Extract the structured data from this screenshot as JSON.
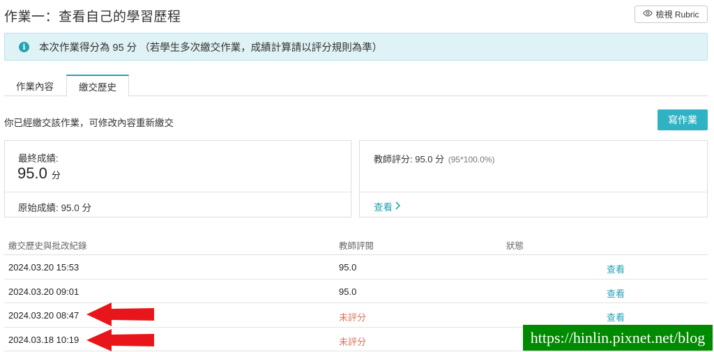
{
  "header": {
    "title": "作業一：查看自己的學習歷程",
    "rubric_button": "檢視 Rubric"
  },
  "info_bar": {
    "message": "本次作業得分為 95 分 （若學生多次繳交作業，成績計算請以評分規則為準）"
  },
  "tabs": [
    {
      "label": "作業內容",
      "active": false
    },
    {
      "label": "繳交歷史",
      "active": true
    }
  ],
  "status_text": "你已經繳交該作業，可修改內容重新繳交",
  "write_button": "寫作業",
  "final_card": {
    "label": "最終成績:",
    "score": "95.0",
    "unit": "分",
    "original": "原始成績: 95.0 分"
  },
  "teacher_card": {
    "label": "教師評分: 95.0 分",
    "formula": "(95*100.0%)",
    "view_link": "查看"
  },
  "history_table": {
    "headers": [
      "繳交歷史與批改紀錄",
      "教師評閱",
      "狀態",
      ""
    ],
    "rows": [
      {
        "time": "2024.03.20 15:53",
        "review": "95.0",
        "status": "",
        "action": "查看",
        "graded": true
      },
      {
        "time": "2024.03.20 09:01",
        "review": "95.0",
        "status": "",
        "action": "查看",
        "graded": true
      },
      {
        "time": "2024.03.20 08:47",
        "review": "未評分",
        "status": "",
        "action": "查看",
        "graded": false
      },
      {
        "time": "2024.03.18 10:19",
        "review": "未評分",
        "status": "",
        "action": "",
        "graded": false
      }
    ]
  },
  "watermark": "https://hinlin.pixnet.net/blog",
  "colors": {
    "accent": "#2fb3c4",
    "info_bg": "#dff2f5",
    "ungraded": "#d9735e",
    "arrow": "#e8161a",
    "watermark_bg": "#008a00"
  },
  "icons": [
    "eye-icon",
    "info-icon",
    "chevron-right-icon",
    "red-arrow-icon"
  ]
}
